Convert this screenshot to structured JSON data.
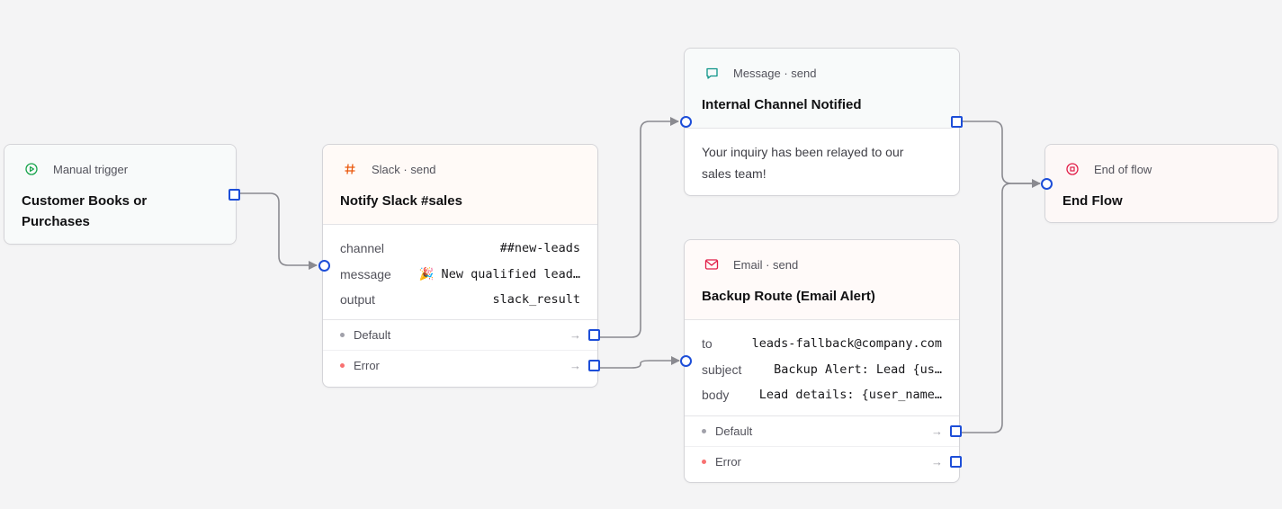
{
  "colors": {
    "port": "#1d4ed8",
    "edge": "#8a8a90",
    "trigger_icon": "#16a34a",
    "slack_icon": "#ea580c",
    "message_icon": "#0d9488",
    "email_icon": "#e11d48",
    "end_icon": "#e11d48"
  },
  "nodes": {
    "trigger": {
      "icon": "play-circle-icon",
      "type_label": "Manual trigger",
      "title": "Customer Books or Purchases"
    },
    "slack": {
      "icon": "hash-icon",
      "type_label": "Slack · send",
      "title": "Notify Slack #sales",
      "props": [
        {
          "key": "channel",
          "value": "##new-leads"
        },
        {
          "key": "message",
          "value": "🎉 New qualified lead…"
        },
        {
          "key": "output",
          "value": "slack_result"
        }
      ],
      "outputs": [
        {
          "label": "Default"
        },
        {
          "label": "Error"
        }
      ]
    },
    "message": {
      "icon": "message-square-icon",
      "type_label": "Message · send",
      "title": "Internal Channel Notified",
      "body": "Your inquiry has been relayed to our sales team!"
    },
    "email": {
      "icon": "mail-icon",
      "type_label": "Email · send",
      "title": "Backup Route (Email Alert)",
      "props": [
        {
          "key": "to",
          "value": "leads-fallback@company.com"
        },
        {
          "key": "subject",
          "value": "Backup Alert: Lead {us…"
        },
        {
          "key": "body",
          "value": "Lead details: {user_name…"
        }
      ],
      "outputs": [
        {
          "label": "Default"
        },
        {
          "label": "Error"
        }
      ]
    },
    "end": {
      "icon": "stop-circle-icon",
      "type_label": "End of flow",
      "title": "End Flow"
    }
  }
}
